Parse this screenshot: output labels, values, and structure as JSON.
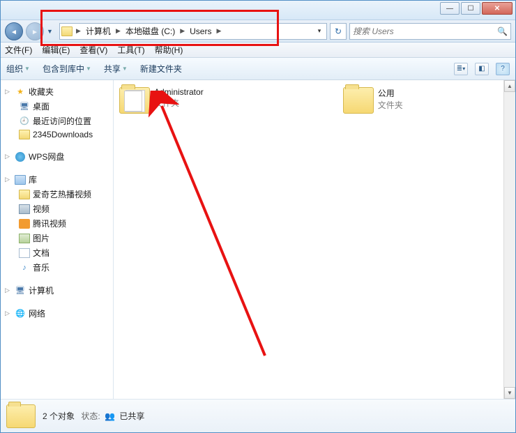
{
  "window_controls": {
    "min": "—",
    "max": "☐",
    "close": "✕"
  },
  "breadcrumbs": [
    "计算机",
    "本地磁盘 (C:)",
    "Users"
  ],
  "search": {
    "placeholder": "搜索 Users"
  },
  "menubar": [
    "文件(F)",
    "编辑(E)",
    "查看(V)",
    "工具(T)",
    "帮助(H)"
  ],
  "toolbar": {
    "organize": "组织",
    "include": "包含到库中",
    "share": "共享",
    "newfolder": "新建文件夹"
  },
  "sidebar": {
    "favorites": {
      "label": "收藏夹",
      "items": [
        "桌面",
        "最近访问的位置",
        "2345Downloads"
      ]
    },
    "wps": {
      "label": "WPS网盘"
    },
    "libraries": {
      "label": "库",
      "items": [
        "爱奇艺热播视频",
        "视频",
        "腾讯视频",
        "图片",
        "文档",
        "音乐"
      ]
    },
    "computer": {
      "label": "计算机"
    },
    "network": {
      "label": "网络"
    }
  },
  "folders": [
    {
      "name": "Administrator",
      "type": "文件夹"
    },
    {
      "name": "公用",
      "type": "文件夹"
    }
  ],
  "status": {
    "count": "2 个对象",
    "state_label": "状态:",
    "state_value": "已共享"
  }
}
